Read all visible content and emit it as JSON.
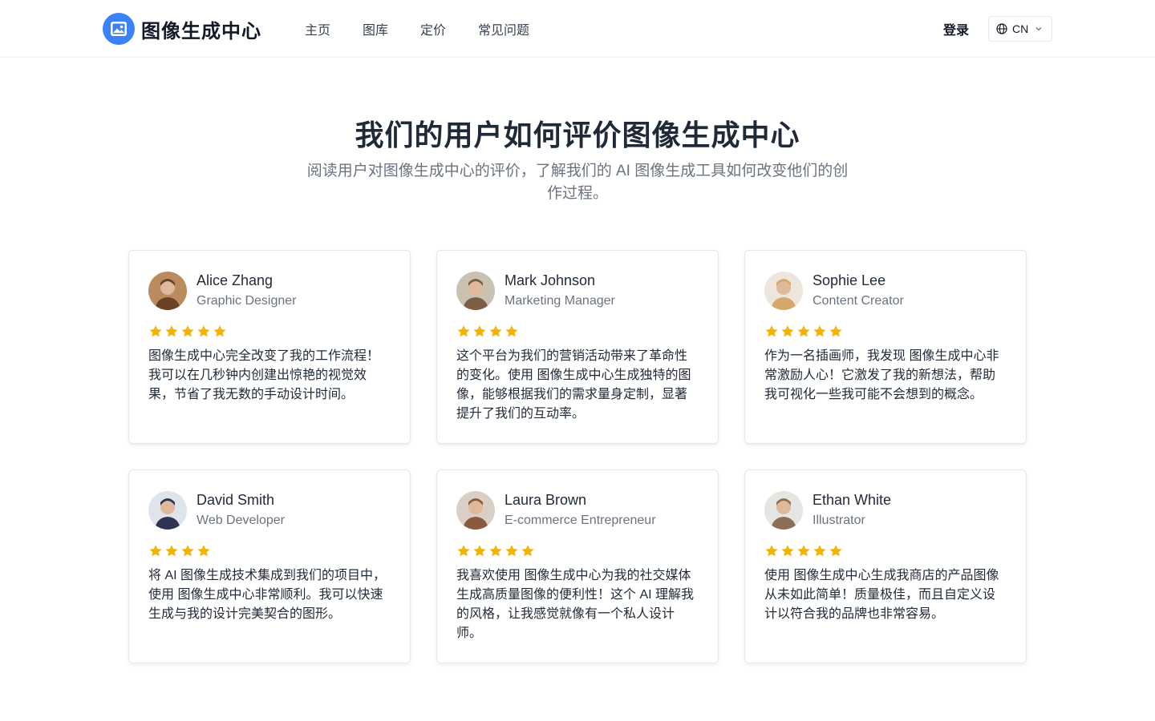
{
  "header": {
    "logo_text": "图像生成中心",
    "nav": [
      "主页",
      "图库",
      "定价",
      "常见问题"
    ],
    "login_label": "登录",
    "lang_label": "CN"
  },
  "hero": {
    "title": "我们的用户如何评价图像生成中心",
    "subtitle": "阅读用户对图像生成中心的评价，了解我们的 AI 图像生成工具如何改变他们的创作过程。"
  },
  "colors": {
    "accent": "#3b82f6",
    "star": "#f5b301"
  },
  "testimonials": [
    {
      "name": "Alice Zhang",
      "role": "Graphic Designer",
      "rating": 5,
      "avatar_bg": "#b98b5e",
      "avatar_fg": "#6b4226",
      "quote": "图像生成中心完全改变了我的工作流程！我可以在几秒钟内创建出惊艳的视觉效果，节省了我无数的手动设计时间。"
    },
    {
      "name": "Mark Johnson",
      "role": "Marketing Manager",
      "rating": 4,
      "avatar_bg": "#c9c2b3",
      "avatar_fg": "#7a5f45",
      "quote": "这个平台为我们的营销活动带来了革命性的变化。使用 图像生成中心生成独特的图像，能够根据我们的需求量身定制，显著提升了我们的互动率。"
    },
    {
      "name": "Sophie Lee",
      "role": "Content Creator",
      "rating": 5,
      "avatar_bg": "#ede6dd",
      "avatar_fg": "#d4a86a",
      "quote": "作为一名插画师，我发现 图像生成中心非常激励人心！它激发了我的新想法，帮助我可视化一些我可能不会想到的概念。"
    },
    {
      "name": "David Smith",
      "role": "Web Developer",
      "rating": 4,
      "avatar_bg": "#dfe3ec",
      "avatar_fg": "#2f3550",
      "quote": "将 AI 图像生成技术集成到我们的项目中，使用 图像生成中心非常顺利。我可以快速生成与我的设计完美契合的图形。"
    },
    {
      "name": "Laura Brown",
      "role": "E-commerce Entrepreneur",
      "rating": 5,
      "avatar_bg": "#d9cfc4",
      "avatar_fg": "#8a5a3c",
      "quote": "我喜欢使用 图像生成中心为我的社交媒体生成高质量图像的便利性！这个 AI 理解我的风格，让我感觉就像有一个私人设计师。"
    },
    {
      "name": "Ethan White",
      "role": "Illustrator",
      "rating": 5,
      "avatar_bg": "#e3e6e1",
      "avatar_fg": "#8d6e58",
      "quote": "使用 图像生成中心生成我商店的产品图像从未如此简单！质量极佳，而且自定义设计以符合我的品牌也非常容易。"
    }
  ]
}
